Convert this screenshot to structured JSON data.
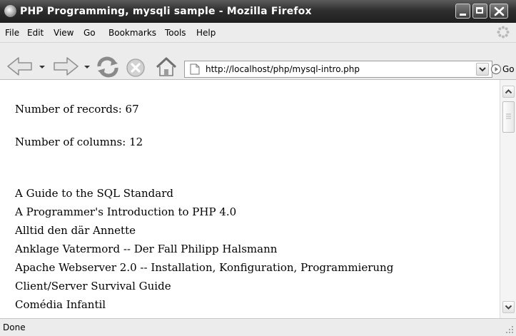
{
  "window": {
    "title": "PHP Programming, mysqli sample - Mozilla Firefox"
  },
  "menu": [
    "File",
    "Edit",
    "View",
    "Go",
    "Bookmarks",
    "Tools",
    "Help"
  ],
  "toolbar": {
    "url": "http://localhost/php/mysql-intro.php",
    "go_label": "Go"
  },
  "content": {
    "records_line": "Number of records: 67",
    "columns_line": "Number of columns: 12",
    "titles": [
      "A Guide to the SQL Standard",
      "A Programmer's Introduction to PHP 4.0",
      "Alltid den där Annette",
      "Anklage Vatermord -- Der Fall Philipp Halsmann",
      "Apache Webserver 2.0 -- Installation, Konfiguration, Programmierung",
      "Client/Server Survival Guide",
      "Comédia Infantil"
    ]
  },
  "status": {
    "text": "Done"
  },
  "scroll": {
    "position": 0.0
  }
}
